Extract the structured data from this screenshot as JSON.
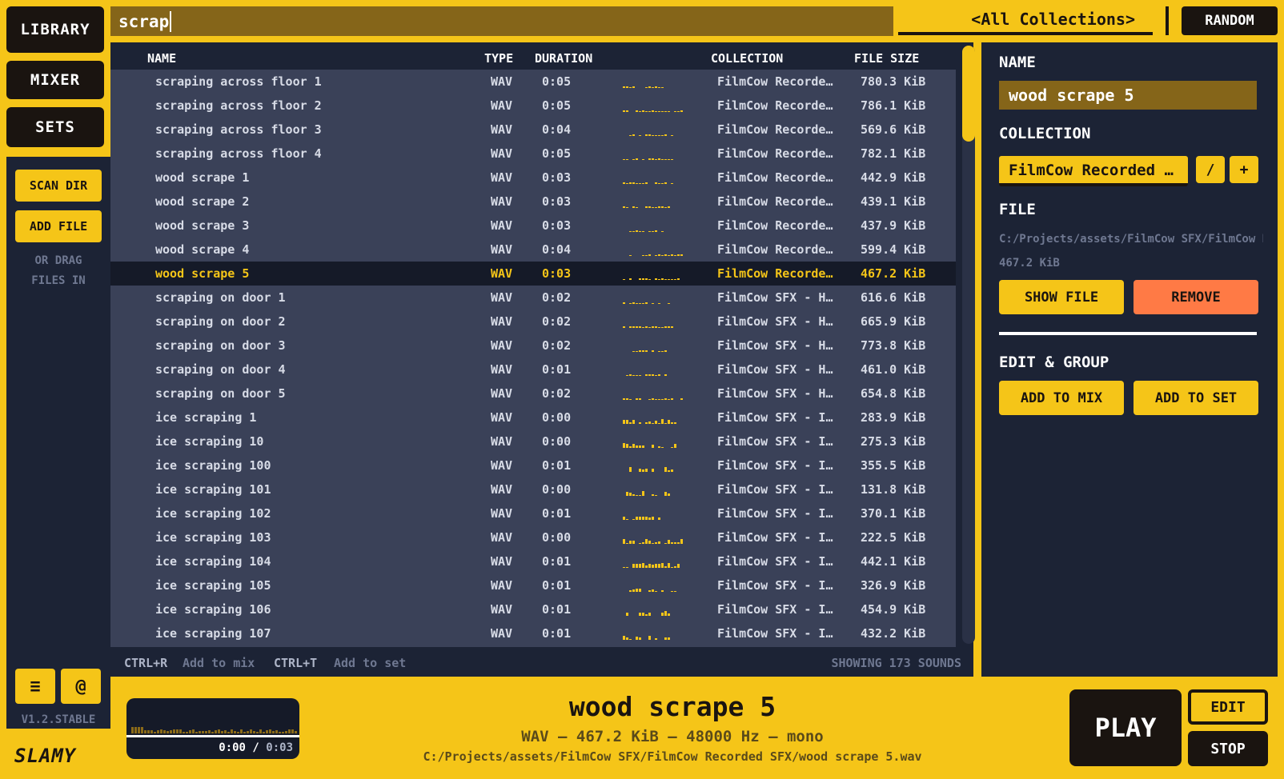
{
  "nav": {
    "library": "LIBRARY",
    "mixer": "MIXER",
    "sets": "SETS"
  },
  "sidebar": {
    "scan_dir": "SCAN DIR",
    "add_file": "ADD FILE",
    "drag_line1": "OR DRAG",
    "drag_line2": "FILES IN",
    "menu_icon": "hamburger-icon",
    "at_icon": "at-icon",
    "menu_glyph": "≡",
    "at_glyph": "@",
    "version": "V1.2.STABLE",
    "logo": "SLAMY"
  },
  "search": {
    "value": "scrap"
  },
  "collection_filter": {
    "label": "<All Collections>"
  },
  "random_label": "RANDOM",
  "table": {
    "headers": {
      "name": "NAME",
      "type": "TYPE",
      "duration": "DURATION",
      "collection": "COLLECTION",
      "size": "FILE SIZE"
    },
    "rows": [
      {
        "name": "scraping across floor 1",
        "type": "WAV",
        "dur": "0:05",
        "coll": "FilmCow Recorded SFX",
        "size": "780.3 KiB"
      },
      {
        "name": "scraping across floor 2",
        "type": "WAV",
        "dur": "0:05",
        "coll": "FilmCow Recorded SFX",
        "size": "786.1 KiB"
      },
      {
        "name": "scraping across floor 3",
        "type": "WAV",
        "dur": "0:04",
        "coll": "FilmCow Recorded SFX",
        "size": "569.6 KiB"
      },
      {
        "name": "scraping across floor 4",
        "type": "WAV",
        "dur": "0:05",
        "coll": "FilmCow Recorded SFX",
        "size": "782.1 KiB"
      },
      {
        "name": "wood scrape 1",
        "type": "WAV",
        "dur": "0:03",
        "coll": "FilmCow Recorded SFX",
        "size": "442.9 KiB"
      },
      {
        "name": "wood scrape 2",
        "type": "WAV",
        "dur": "0:03",
        "coll": "FilmCow Recorded SFX",
        "size": "439.1 KiB"
      },
      {
        "name": "wood scrape 3",
        "type": "WAV",
        "dur": "0:03",
        "coll": "FilmCow Recorded SFX",
        "size": "437.9 KiB"
      },
      {
        "name": "wood scrape 4",
        "type": "WAV",
        "dur": "0:04",
        "coll": "FilmCow Recorded SFX",
        "size": "599.4 KiB"
      },
      {
        "name": "wood scrape 5",
        "type": "WAV",
        "dur": "0:03",
        "coll": "FilmCow Recorded SFX",
        "size": "467.2 KiB"
      },
      {
        "name": "scraping on door 1",
        "type": "WAV",
        "dur": "0:02",
        "coll": "FilmCow SFX - Household",
        "size": "616.6 KiB"
      },
      {
        "name": "scraping on door 2",
        "type": "WAV",
        "dur": "0:02",
        "coll": "FilmCow SFX - Household",
        "size": "665.9 KiB"
      },
      {
        "name": "scraping on door 3",
        "type": "WAV",
        "dur": "0:02",
        "coll": "FilmCow SFX - Household",
        "size": "773.8 KiB"
      },
      {
        "name": "scraping on door 4",
        "type": "WAV",
        "dur": "0:01",
        "coll": "FilmCow SFX - Household",
        "size": "461.0 KiB"
      },
      {
        "name": "scraping on door 5",
        "type": "WAV",
        "dur": "0:02",
        "coll": "FilmCow SFX - Household",
        "size": "654.8 KiB"
      },
      {
        "name": "ice scraping 1",
        "type": "WAV",
        "dur": "0:00",
        "coll": "FilmCow SFX - Ice",
        "size": "283.9 KiB"
      },
      {
        "name": "ice scraping 10",
        "type": "WAV",
        "dur": "0:00",
        "coll": "FilmCow SFX - Ice",
        "size": "275.3 KiB"
      },
      {
        "name": "ice scraping 100",
        "type": "WAV",
        "dur": "0:01",
        "coll": "FilmCow SFX - Ice",
        "size": "355.5 KiB"
      },
      {
        "name": "ice scraping 101",
        "type": "WAV",
        "dur": "0:00",
        "coll": "FilmCow SFX - Ice",
        "size": "131.8 KiB"
      },
      {
        "name": "ice scraping 102",
        "type": "WAV",
        "dur": "0:01",
        "coll": "FilmCow SFX - Ice",
        "size": "370.1 KiB"
      },
      {
        "name": "ice scraping 103",
        "type": "WAV",
        "dur": "0:00",
        "coll": "FilmCow SFX - Ice",
        "size": "222.5 KiB"
      },
      {
        "name": "ice scraping 104",
        "type": "WAV",
        "dur": "0:01",
        "coll": "FilmCow SFX - Ice",
        "size": "442.1 KiB"
      },
      {
        "name": "ice scraping 105",
        "type": "WAV",
        "dur": "0:01",
        "coll": "FilmCow SFX - Ice",
        "size": "326.9 KiB"
      },
      {
        "name": "ice scraping 106",
        "type": "WAV",
        "dur": "0:01",
        "coll": "FilmCow SFX - Ice",
        "size": "454.9 KiB"
      },
      {
        "name": "ice scraping 107",
        "type": "WAV",
        "dur": "0:01",
        "coll": "FilmCow SFX - Ice",
        "size": "432.2 KiB"
      }
    ],
    "selected_index": 8
  },
  "footer": {
    "k1": "CTRL+R",
    "k1_desc": "Add to mix",
    "k2": "CTRL+T",
    "k2_desc": "Add to set",
    "count": "SHOWING 173 SOUNDS"
  },
  "details": {
    "name_label": "NAME",
    "name_value": "wood scrape 5",
    "collection_label": "COLLECTION",
    "collection_value": "FilmCow Recorded SFX",
    "edit_glyph": "/",
    "add_glyph": "+",
    "file_label": "FILE",
    "file_path": "C:/Projects/assets/FilmCow SFX/FilmCow Recorded SFX/wood scrape 5.wav",
    "file_size": "467.2 KiB",
    "show_file": "SHOW FILE",
    "remove": "REMOVE",
    "edit_group_label": "EDIT & GROUP",
    "add_to_mix": "ADD TO MIX",
    "add_to_set": "ADD TO SET"
  },
  "player": {
    "title": "wood scrape 5",
    "meta": "WAV — 467.2 KiB — 48000 Hz — mono",
    "path": "C:/Projects/assets/FilmCow SFX/FilmCow Recorded SFX/wood scrape 5.wav",
    "time_current": "0:00",
    "time_sep": " / ",
    "time_total": "0:03",
    "play": "PLAY",
    "edit": "EDIT",
    "stop": "STOP"
  },
  "colors": {
    "accent": "#f5c518",
    "dark": "#1a1410",
    "panel": "#1c2335",
    "row_bg": "#3a4158",
    "remove": "#ff7a45"
  }
}
